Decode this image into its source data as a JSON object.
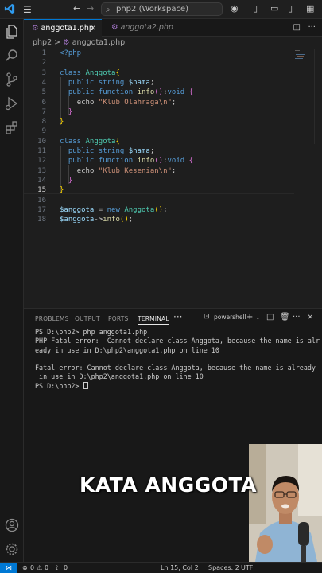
{
  "titlebar": {
    "search_text": "php2 (Workspace)"
  },
  "tabs": [
    {
      "icon": "php",
      "label": "anggota1.php",
      "active": true
    },
    {
      "icon": "php",
      "label": "anggota2.php",
      "active": false
    }
  ],
  "breadcrumb": {
    "folder": "php2",
    "separator": ">",
    "file": "anggota1.php"
  },
  "editor": {
    "current_line": 15,
    "lines": [
      {
        "n": "1",
        "text": "<?php"
      },
      {
        "n": "2",
        "text": ""
      },
      {
        "n": "3",
        "text": "class Anggota{"
      },
      {
        "n": "4",
        "text": "  public string $nama;"
      },
      {
        "n": "5",
        "text": "  public function info():void {"
      },
      {
        "n": "6",
        "text": "    echo \"Klub Olahraga\\n\";"
      },
      {
        "n": "7",
        "text": "  }"
      },
      {
        "n": "8",
        "text": "}"
      },
      {
        "n": "9",
        "text": ""
      },
      {
        "n": "10",
        "text": "class Anggota{"
      },
      {
        "n": "11",
        "text": "  public string $nama;"
      },
      {
        "n": "12",
        "text": "  public function info():void {"
      },
      {
        "n": "13",
        "text": "    echo \"Klub Kesenian\\n\";"
      },
      {
        "n": "14",
        "text": "  }"
      },
      {
        "n": "15",
        "text": "}"
      },
      {
        "n": "16",
        "text": ""
      },
      {
        "n": "17",
        "text": "$anggota = new Anggota();"
      },
      {
        "n": "18",
        "text": "$anggota->info();"
      }
    ]
  },
  "panel": {
    "tabs": [
      "PROBLEMS",
      "OUTPUT",
      "PORTS",
      "TERMINAL"
    ],
    "active_tab": "TERMINAL",
    "more": "···",
    "shell_label": "powershell",
    "terminal_lines": [
      "PS D:\\php2> php anggota1.php",
      "PHP Fatal error:  Cannot declare class Anggota, because the name is alr",
      "eady in use in D:\\php2\\anggota1.php on line 10",
      "",
      "Fatal error: Cannot declare class Anggota, because the name is already",
      " in use in D:\\php2\\anggota1.php on line 10",
      "PS D:\\php2> "
    ]
  },
  "statusbar": {
    "errors": "0",
    "warnings": "0",
    "ports": "0",
    "position": "Ln 15, Col 2",
    "spaces": "Spaces: 2",
    "encoding": "UTF"
  },
  "overlay": {
    "caption": "KATA ANGGOTA"
  },
  "colors": {
    "accent": "#0078d4",
    "php_icon": "#a074c4",
    "keyword": "#569cd6",
    "class_name": "#4ec9b0",
    "string": "#ce9178"
  }
}
